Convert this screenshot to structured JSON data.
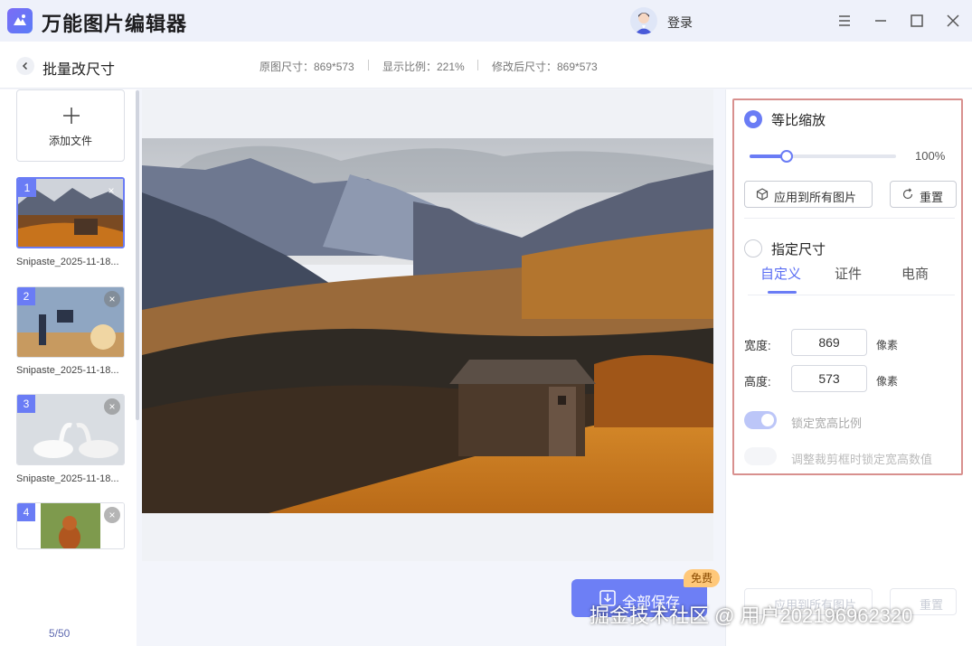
{
  "app": {
    "title": "万能图片编辑器",
    "login": "登录"
  },
  "header": {
    "back_title": "批量改尺寸",
    "original_size": "原图尺寸：869*573",
    "display_ratio": "显示比例：221%",
    "modified_size": "修改后尺寸：869*573"
  },
  "sidebar": {
    "add_file": "添加文件",
    "items": [
      {
        "index": "1",
        "name": "Snipaste_2025-11-18...",
        "selected": true
      },
      {
        "index": "2",
        "name": "Snipaste_2025-11-18..."
      },
      {
        "index": "3",
        "name": "Snipaste_2025-11-18..."
      },
      {
        "index": "4",
        "name": ""
      }
    ],
    "page_count": "5/50",
    "close_glyph": "×"
  },
  "settings": {
    "proportional_label": "等比缩放",
    "scale_percent": "100%",
    "scale_value": 0.25,
    "apply_all": "应用到所有图片",
    "reset": "重置",
    "specify_label": "指定尺寸",
    "tabs": [
      "自定义",
      "证件",
      "电商"
    ],
    "width_label": "宽度:",
    "width_value": "869",
    "height_label": "高度:",
    "height_value": "573",
    "unit": "像素",
    "lock_ratio": "锁定宽高比例",
    "lock_crop": "调整裁剪框时锁定宽高数值"
  },
  "footer": {
    "save_all": "全部保存",
    "free_badge": "免费",
    "apply_all_ghost": "应用到所有图片",
    "reset_ghost": "重置"
  },
  "watermark": "掘金技术社区 @ 用户202196962320",
  "colors": {
    "accent": "#6a7cf5",
    "highlight_border": "#d8908e"
  }
}
